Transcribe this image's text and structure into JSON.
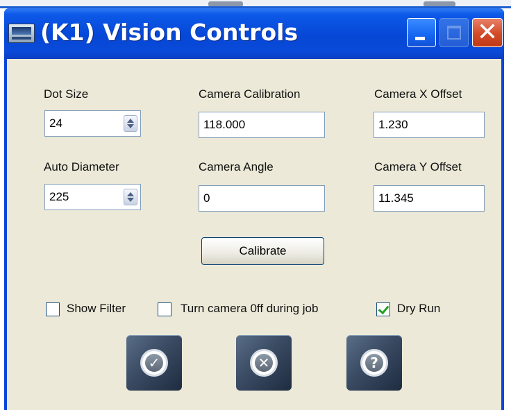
{
  "window": {
    "title": "(K1) Vision Controls",
    "icons": {
      "app": "app-icon",
      "minimize": "minimize-icon",
      "maximize": "maximize-icon",
      "close": "close-icon"
    },
    "close_glyph": "✕"
  },
  "fields": {
    "dot_size": {
      "label": "Dot Size",
      "value": "24"
    },
    "auto_diameter": {
      "label": "Auto Diameter",
      "value": "225"
    },
    "camera_calibration": {
      "label": "Camera Calibration",
      "value": "118.000"
    },
    "camera_angle": {
      "label": "Camera Angle",
      "value": "0"
    },
    "camera_x_offset": {
      "label": "Camera X Offset",
      "value": "1.230"
    },
    "camera_y_offset": {
      "label": "Camera Y Offset",
      "value": "11.345"
    }
  },
  "buttons": {
    "calibrate": "Calibrate"
  },
  "checkboxes": [
    {
      "label": "Show Filter",
      "checked": false
    },
    {
      "label": "Turn camera 0ff during job",
      "checked": false
    },
    {
      "label": "Dry Run",
      "checked": true
    }
  ],
  "actions": [
    {
      "name": "ok",
      "icon": "checkmark-icon",
      "glyph": "✓"
    },
    {
      "name": "cancel",
      "icon": "cancel-x-icon",
      "glyph": "✕"
    },
    {
      "name": "help",
      "icon": "question-icon",
      "glyph": "?"
    }
  ],
  "colors": {
    "titlebar": "#0647d6",
    "client_bg": "#ece9d8",
    "checkmark": "#21a121",
    "close_button": "#d24a26"
  }
}
